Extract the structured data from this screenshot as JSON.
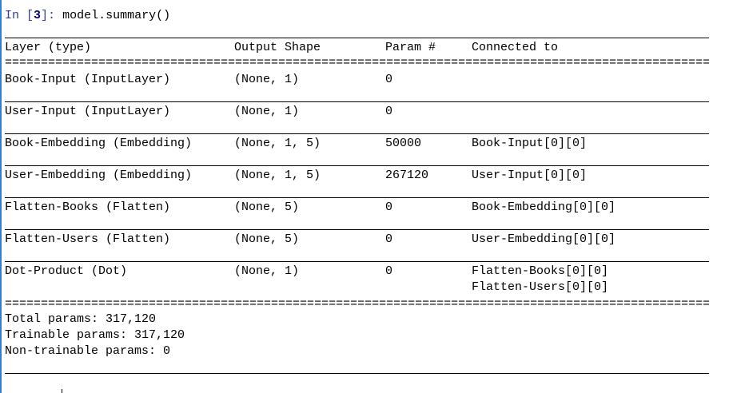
{
  "prompt": {
    "label": "In",
    "number": "3",
    "code": "model.summary()"
  },
  "table": {
    "headers": [
      "Layer (type)",
      "Output Shape",
      "Param #",
      "Connected to"
    ],
    "rows": [
      {
        "layer": "Book-Input (InputLayer)",
        "shape": "(None, 1)",
        "params": "0",
        "connected": [
          "",
          ""
        ]
      },
      {
        "layer": "User-Input (InputLayer)",
        "shape": "(None, 1)",
        "params": "0",
        "connected": [
          "",
          ""
        ]
      },
      {
        "layer": "Book-Embedding (Embedding)",
        "shape": "(None, 1, 5)",
        "params": "50000",
        "connected": [
          "Book-Input[0][0]",
          ""
        ]
      },
      {
        "layer": "User-Embedding (Embedding)",
        "shape": "(None, 1, 5)",
        "params": "267120",
        "connected": [
          "User-Input[0][0]",
          ""
        ]
      },
      {
        "layer": "Flatten-Books (Flatten)",
        "shape": "(None, 5)",
        "params": "0",
        "connected": [
          "Book-Embedding[0][0]",
          ""
        ]
      },
      {
        "layer": "Flatten-Users (Flatten)",
        "shape": "(None, 5)",
        "params": "0",
        "connected": [
          "User-Embedding[0][0]",
          ""
        ]
      },
      {
        "layer": "Dot-Product (Dot)",
        "shape": "(None, 1)",
        "params": "0",
        "connected": [
          "Flatten-Books[0][0]",
          "Flatten-Users[0][0]"
        ]
      }
    ]
  },
  "totals": {
    "total": "Total params: 317,120",
    "trainable": "Trainable params: 317,120",
    "non_trainable": "Non-trainable params: 0"
  },
  "colors": {
    "cell_border": "#2f7fd6",
    "prompt": "#303f9f"
  }
}
